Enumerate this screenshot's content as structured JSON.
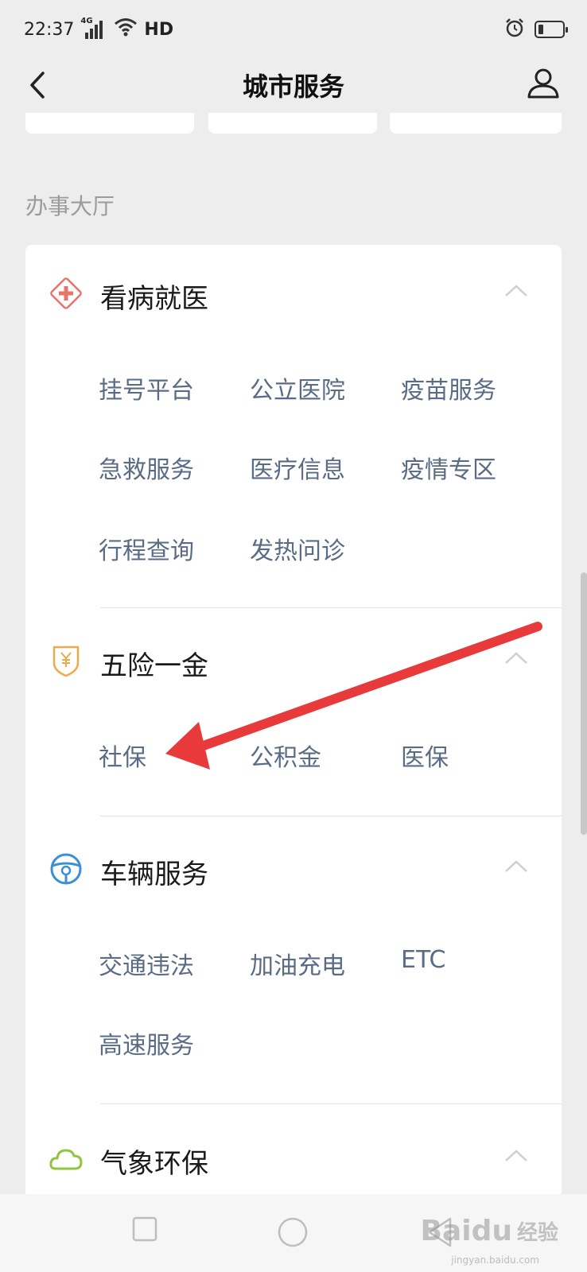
{
  "status_bar": {
    "time": "22:37",
    "network": "4G",
    "hd": "HD",
    "icons": [
      "signal-icon",
      "wifi-icon",
      "alarm-icon",
      "battery-icon"
    ]
  },
  "nav": {
    "title": "城市服务",
    "back_icon": "chevron-left-icon",
    "profile_icon": "user-icon"
  },
  "section_label": "办事大厅",
  "categories": [
    {
      "title": "看病就医",
      "icon": "medical-cross-icon",
      "icon_color": "#e8736b",
      "items": [
        "挂号平台",
        "公立医院",
        "疫苗服务",
        "急救服务",
        "医疗信息",
        "疫情专区",
        "行程查询",
        "发热问诊"
      ]
    },
    {
      "title": "五险一金",
      "icon": "yen-shield-icon",
      "icon_color": "#f0a94a",
      "items": [
        "社保",
        "公积金",
        "医保"
      ]
    },
    {
      "title": "车辆服务",
      "icon": "steering-wheel-icon",
      "icon_color": "#3a8fd6",
      "items": [
        "交通违法",
        "加油充电",
        "ETC",
        "高速服务"
      ]
    },
    {
      "title": "气象环保",
      "icon": "cloud-icon",
      "icon_color": "#8ec63f",
      "items": []
    }
  ],
  "annotation": {
    "arrow_color": "#e8393b",
    "target": "社保"
  },
  "watermark": {
    "brand": "Baidu",
    "suffix": "经验",
    "url": "jingyan.baidu.com"
  }
}
